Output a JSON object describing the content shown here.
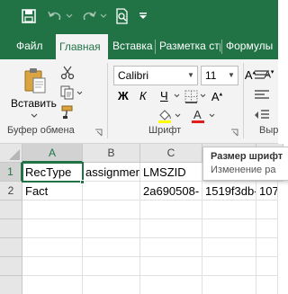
{
  "colors": {
    "accent": "#217346",
    "ribbon_bg": "#f3f3f3",
    "header_bg": "#e6e6e6",
    "font_color_bar": "#e21b1b",
    "highlight_bar": "#ffff00"
  },
  "tabs": [
    {
      "label": "Файл",
      "active": false
    },
    {
      "label": "Главная",
      "active": true
    },
    {
      "label": "Вставка",
      "active": false
    },
    {
      "label": "Разметка стр",
      "active": false
    },
    {
      "label": "Формулы",
      "active": false
    }
  ],
  "ribbon": {
    "clipboard": {
      "paste_label": "Вставить",
      "group_label": "Буфер обмена"
    },
    "font": {
      "name": "Calibri",
      "size": "11",
      "bold": "Ж",
      "italic": "К",
      "underline": "Ч",
      "group_label": "Шрифт"
    },
    "next_group_label": "Выр"
  },
  "sheet": {
    "columns": [
      "A",
      "B",
      "C"
    ],
    "rows": [
      "1",
      "2"
    ],
    "cells": {
      "A1": "RecType",
      "B1": "assignmen",
      "C1": "LMSZID",
      "A2": "Fact",
      "C2": "2a690508-",
      "D2": "1519f3db-",
      "E2": "107"
    }
  },
  "tooltip": {
    "title": "Размер шрифт",
    "desc": "Изменение ра"
  }
}
